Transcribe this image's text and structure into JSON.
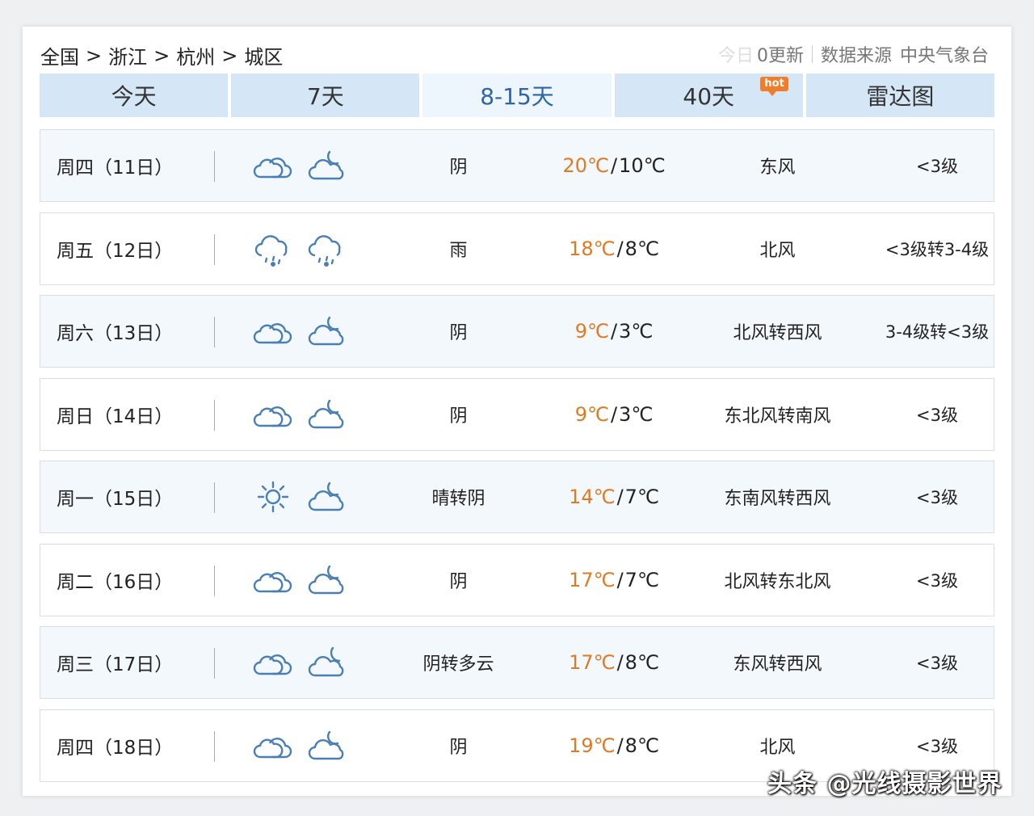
{
  "breadcrumb": [
    "全国",
    "浙江",
    "杭州",
    "城区"
  ],
  "breadcrumb_sep": ">",
  "update": {
    "blurred": "今日",
    "text": "0更新",
    "source_label": "数据来源",
    "source_name": "中央气象台"
  },
  "tabs": [
    {
      "label": "今天"
    },
    {
      "label": "7天"
    },
    {
      "label": "8-15天",
      "active": true
    },
    {
      "label": "40天",
      "badge": "hot"
    },
    {
      "label": "雷达图"
    }
  ],
  "temp_unit": "℃",
  "days": [
    {
      "date": "周四（11日）",
      "icon_day": "cloudy-icon",
      "icon_night": "cloudy-night-icon",
      "condition": "阴",
      "high": "20℃",
      "low": "10℃",
      "wind": "东风",
      "level": "<3级"
    },
    {
      "date": "周五（12日）",
      "icon_day": "rain-icon",
      "icon_night": "rain-icon",
      "condition": "雨",
      "high": "18℃",
      "low": "8℃",
      "wind": "北风",
      "level": "<3级转3-4级"
    },
    {
      "date": "周六（13日）",
      "icon_day": "cloudy-icon",
      "icon_night": "cloudy-night-icon",
      "condition": "阴",
      "high": "9℃",
      "low": "3℃",
      "wind": "北风转西风",
      "level": "3-4级转<3级"
    },
    {
      "date": "周日（14日）",
      "icon_day": "cloudy-icon",
      "icon_night": "cloudy-night-icon",
      "condition": "阴",
      "high": "9℃",
      "low": "3℃",
      "wind": "东北风转南风",
      "level": "<3级"
    },
    {
      "date": "周一（15日）",
      "icon_day": "sun-icon",
      "icon_night": "cloudy-night-icon",
      "condition": "晴转阴",
      "high": "14℃",
      "low": "7℃",
      "wind": "东南风转西风",
      "level": "<3级"
    },
    {
      "date": "周二（16日）",
      "icon_day": "cloudy-icon",
      "icon_night": "cloudy-night-icon",
      "condition": "阴",
      "high": "17℃",
      "low": "7℃",
      "wind": "北风转东北风",
      "level": "<3级"
    },
    {
      "date": "周三（17日）",
      "icon_day": "cloudy-icon",
      "icon_night": "partly-cloudy-night-icon",
      "condition": "阴转多云",
      "high": "17℃",
      "low": "8℃",
      "wind": "东风转西风",
      "level": "<3级"
    },
    {
      "date": "周四（18日）",
      "icon_day": "cloudy-icon",
      "icon_night": "cloudy-night-icon",
      "condition": "阴",
      "high": "19℃",
      "low": "8℃",
      "wind": "北风",
      "level": "<3级"
    }
  ],
  "colors": {
    "high_temp": "#e07a22",
    "tab_bg": "#d5e7f6",
    "tab_active_text": "#2e64a8",
    "icon_stroke": "#4a7fb5"
  },
  "watermark": "头条 @光线摄影世界"
}
